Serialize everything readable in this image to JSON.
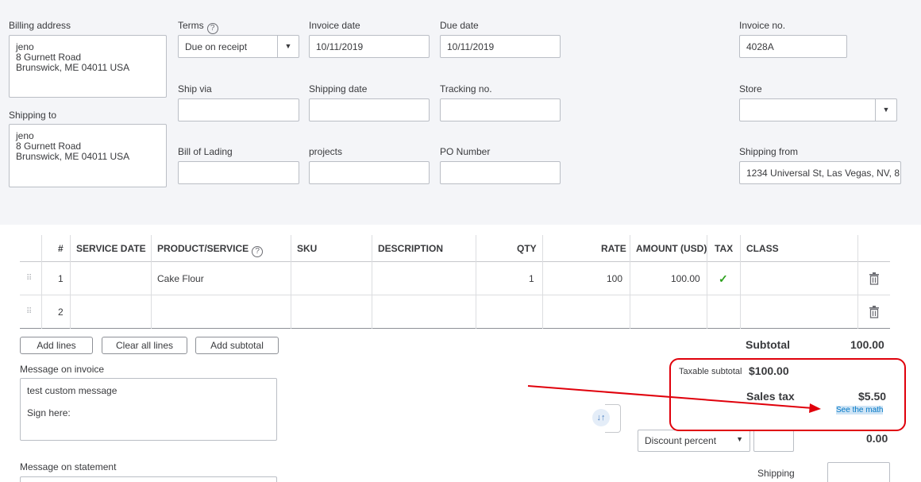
{
  "billing": {
    "label": "Billing address",
    "lines": [
      "jeno",
      "8 Gurnett Road",
      "Brunswick, ME  04011 USA"
    ]
  },
  "shipping_to": {
    "label": "Shipping to",
    "lines": [
      "jeno",
      "8 Gurnett Road",
      "Brunswick, ME  04011 USA"
    ]
  },
  "terms": {
    "label": "Terms",
    "value": "Due on receipt"
  },
  "invoice_date": {
    "label": "Invoice date",
    "value": "10/11/2019"
  },
  "due_date": {
    "label": "Due date",
    "value": "10/11/2019"
  },
  "invoice_no": {
    "label": "Invoice no.",
    "value": "4028A"
  },
  "ship_via": {
    "label": "Ship via",
    "value": ""
  },
  "shipping_date": {
    "label": "Shipping date",
    "value": ""
  },
  "tracking_no": {
    "label": "Tracking no.",
    "value": ""
  },
  "store": {
    "label": "Store",
    "value": ""
  },
  "bill_of_lading": {
    "label": "Bill of Lading",
    "value": ""
  },
  "projects": {
    "label": "projects",
    "value": ""
  },
  "po_number": {
    "label": "PO Number",
    "value": ""
  },
  "shipping_from": {
    "label": "Shipping from",
    "value": "1234 Universal St, Las Vegas, NV, 8"
  },
  "table": {
    "headers": {
      "num": "#",
      "service_date": "SERVICE DATE",
      "product": "PRODUCT/SERVICE",
      "sku": "SKU",
      "description": "DESCRIPTION",
      "qty": "QTY",
      "rate": "RATE",
      "amount": "AMOUNT (USD)",
      "tax": "TAX",
      "class": "CLASS"
    },
    "rows": [
      {
        "num": "1",
        "product": "Cake Flour",
        "qty": "1",
        "rate": "100",
        "amount": "100.00",
        "tax_check": "✓"
      },
      {
        "num": "2",
        "product": "",
        "qty": "",
        "rate": "",
        "amount": "",
        "tax_check": ""
      }
    ]
  },
  "buttons": {
    "add_lines": "Add lines",
    "clear_all_lines": "Clear all lines",
    "add_subtotal": "Add subtotal"
  },
  "message_invoice": {
    "label": "Message on invoice",
    "lines": [
      "test custom message",
      "",
      "Sign here:"
    ]
  },
  "message_statement": {
    "label": "Message on statement"
  },
  "totals": {
    "subtotal_label": "Subtotal",
    "subtotal_value": "100.00",
    "taxable_label": "Taxable subtotal",
    "taxable_value": "$100.00",
    "sales_tax_label": "Sales tax",
    "sales_tax_value": "$5.50",
    "see_math": "See the math",
    "discount_select": "Discount percent",
    "discount_value": "0.00",
    "shipping_label": "Shipping"
  },
  "colors": {
    "panel_bg": "#f4f5f8",
    "annotation_red": "#e0000b",
    "link_blue": "#0077c5",
    "check_green": "#2ca01c"
  }
}
